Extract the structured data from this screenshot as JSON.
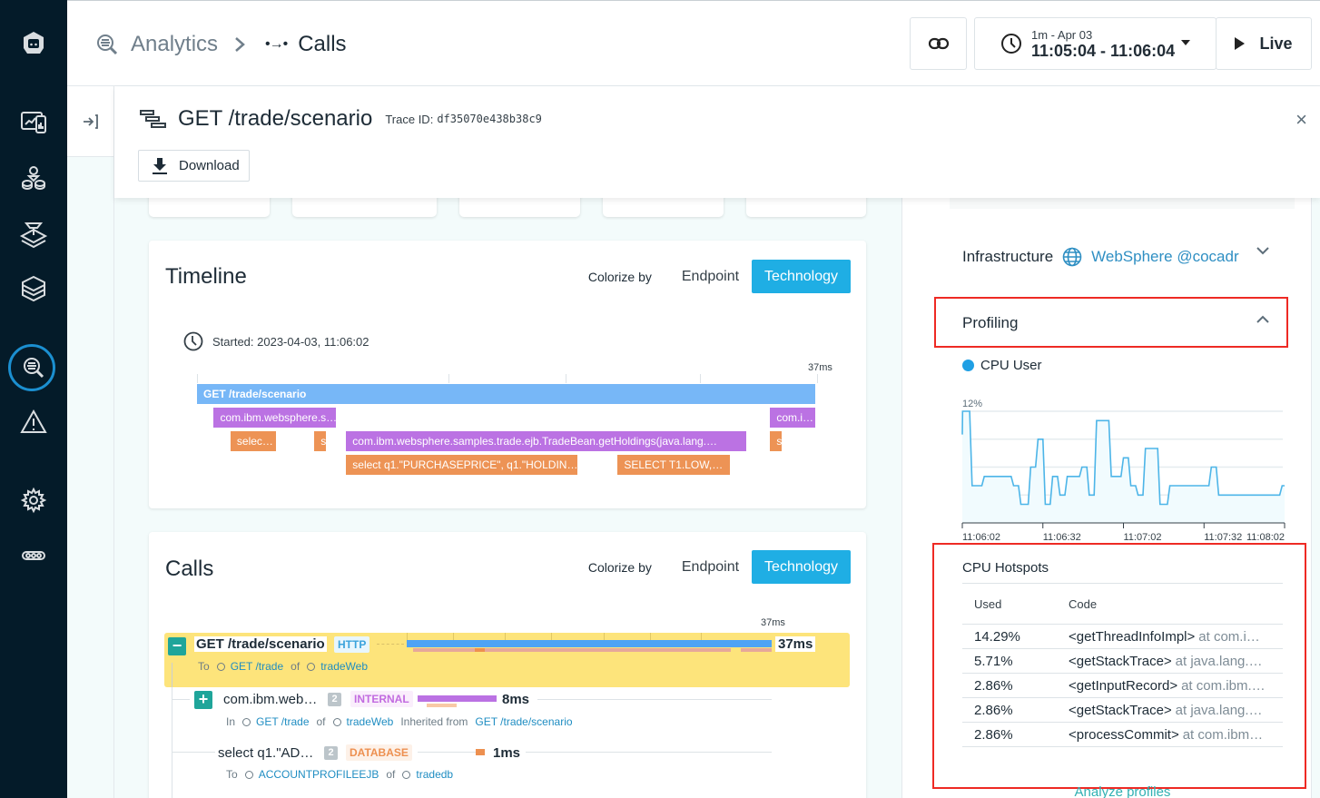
{
  "nav": {
    "items": [
      {
        "name": "websites-mobile",
        "icon": "dashboard-icon"
      },
      {
        "name": "applications",
        "icon": "application-topology-icon"
      },
      {
        "name": "platforms",
        "icon": "platform-icon"
      },
      {
        "name": "infrastructure",
        "icon": "layers-icon"
      },
      {
        "name": "analytics",
        "icon": "analytics-icon",
        "active": true
      },
      {
        "name": "events",
        "icon": "warning-icon"
      },
      {
        "name": "settings",
        "icon": "gear-icon"
      },
      {
        "name": "more",
        "icon": "more-icon"
      }
    ]
  },
  "header": {
    "breadcrumb": [
      {
        "label": "Analytics",
        "icon": "analytics-icon"
      },
      {
        "label": "Calls",
        "icon": "calls-icon"
      }
    ],
    "separator": ">",
    "calls_glyph": "•→•",
    "time_range": {
      "small": "1m - Apr 03",
      "big": "11:05:04 - 11:06:04"
    },
    "live_label": "Live"
  },
  "trace": {
    "title": "GET /trade/scenario",
    "trace_id_label": "Trace ID:",
    "trace_id": "df35070e438b38c9",
    "download_label": "Download",
    "close_glyph": "×"
  },
  "timeline": {
    "title": "Timeline",
    "colorize_label": "Colorize by",
    "options": [
      "Endpoint",
      "Technology"
    ],
    "active_option": "Technology",
    "started": "Started: 2023-04-03, 11:06:02",
    "end_label": "37ms",
    "total_ms": 37,
    "spans": [
      {
        "label": "GET /trade/scenario",
        "type": "http",
        "row": 0,
        "start": 0,
        "end": 37
      },
      {
        "label": "com.ibm.websphere.s…",
        "type": "internal",
        "row": 1,
        "start": 1.0,
        "end": 8.4
      },
      {
        "label": "com.i…",
        "type": "internal",
        "row": 1,
        "start": 34.2,
        "end": 37
      },
      {
        "label": "selec…",
        "type": "db",
        "row": 2,
        "start": 2.0,
        "end": 4.8
      },
      {
        "label": "se",
        "type": "db",
        "row": 2,
        "start": 7.0,
        "end": 7.8
      },
      {
        "label": "com.ibm.websphere.samples.trade.ejb.TradeBean.getHoldings(java.lang.…",
        "type": "internal",
        "row": 2,
        "start": 8.9,
        "end": 32.9
      },
      {
        "label": "se",
        "type": "db",
        "row": 2,
        "start": 34.2,
        "end": 35.0
      },
      {
        "label": "select q1.\"PURCHASEPRICE\", q1.\"HOLDIN…",
        "type": "db",
        "row": 3,
        "start": 8.9,
        "end": 22.8
      },
      {
        "label": "SELECT T1.LOW,…",
        "type": "db",
        "row": 3,
        "start": 25.1,
        "end": 31.9
      }
    ]
  },
  "calls": {
    "title": "Calls",
    "colorize_label": "Colorize by",
    "options": [
      "Endpoint",
      "Technology"
    ],
    "active_option": "Technology",
    "end_label": "37ms",
    "rows": [
      {
        "name": "GET /trade/scenario",
        "badge": "HTTP",
        "duration": "37ms",
        "expander": "−",
        "sub": {
          "prefix": "To",
          "endpoint": "GET /trade",
          "of": "of",
          "service": "tradeWeb"
        }
      },
      {
        "name": "com.ibm.web…",
        "count": "2",
        "badge": "INTERNAL",
        "duration": "8ms",
        "expander": "+",
        "sub": {
          "prefix": "In",
          "endpoint": "GET /trade",
          "of": "of",
          "service": "tradeWeb",
          "inherited_label": "Inherited from",
          "inherited": "GET /trade/scenario"
        }
      },
      {
        "name": "select q1.\"AD…",
        "count": "2",
        "badge": "DATABASE",
        "duration": "1ms",
        "sub": {
          "prefix": "To",
          "endpoint": "ACCOUNTPROFILEEJB",
          "of": "of",
          "service": "tradedb"
        }
      }
    ]
  },
  "right_panel": {
    "infrastructure_label": "Infrastructure",
    "infrastructure_link": "WebSphere @cocadr",
    "profiling_label": "Profiling",
    "hotspots": {
      "title": "CPU Hotspots",
      "columns": [
        "Used",
        "Code"
      ],
      "rows": [
        {
          "used": "14.29%",
          "method": "<getThreadInfoImpl>",
          "at": "at  com.i…"
        },
        {
          "used": "5.71%",
          "method": "<getStackTrace>",
          "at": "at  java.lang.…"
        },
        {
          "used": "2.86%",
          "method": "<getInputRecord>",
          "at": "at  com.ibm.…"
        },
        {
          "used": "2.86%",
          "method": "<getStackTrace>",
          "at": "at  java.lang.…"
        },
        {
          "used": "2.86%",
          "method": "<processCommit>",
          "at": "at  com.ibm…"
        }
      ],
      "analyze_label": "Analyze profiles"
    }
  },
  "colors": {
    "accent": "#1faee4",
    "http": "#77b7f7",
    "internal": "#bb72e3",
    "database": "#ed9355",
    "highlight_row": "#fde47b",
    "cpu_line": "#1f9fe4",
    "annotation_red": "#ee2a24"
  },
  "chart_data": {
    "type": "line",
    "title": "",
    "series": [
      {
        "name": "CPU User",
        "x_seconds": [
          0,
          0.1,
          3,
          4,
          8,
          9,
          20,
          21,
          23,
          24,
          27,
          28,
          30,
          31,
          33,
          34,
          36,
          37,
          39,
          40,
          42,
          43,
          48,
          49,
          51,
          52,
          54,
          55,
          60,
          61,
          65,
          66,
          68,
          69,
          71,
          72,
          74,
          75,
          80,
          81,
          84,
          85,
          91,
          92,
          98,
          99,
          101,
          102,
          104,
          105,
          122,
          123,
          125,
          126,
          130,
          131,
          132
        ],
        "values": [
          9.5,
          12,
          12,
          4,
          4,
          5,
          5,
          4,
          4,
          2,
          2,
          6,
          6,
          9,
          9,
          2,
          2,
          5,
          5,
          3,
          3,
          5,
          5,
          6,
          6,
          3,
          3,
          11,
          11,
          5,
          5,
          7,
          7,
          4,
          4,
          3,
          3,
          8,
          8,
          2,
          2,
          4,
          4,
          4,
          4,
          4,
          4,
          6,
          6,
          3,
          3,
          3,
          3,
          3,
          3,
          4,
          4
        ]
      }
    ],
    "y_unit": "%",
    "ylim": [
      0,
      12
    ],
    "y_tick_labels": [
      "12%"
    ],
    "y_gridlines": [
      3,
      6,
      9,
      12
    ],
    "x_tick_labels": [
      "11:06:02",
      "11:06:32",
      "11:07:02",
      "11:07:32",
      "11:08:02"
    ],
    "x_tick_seconds": [
      0,
      30,
      60,
      90,
      120
    ],
    "x_sublabel": "Apr 03",
    "legend": "top-left",
    "grid": true
  }
}
